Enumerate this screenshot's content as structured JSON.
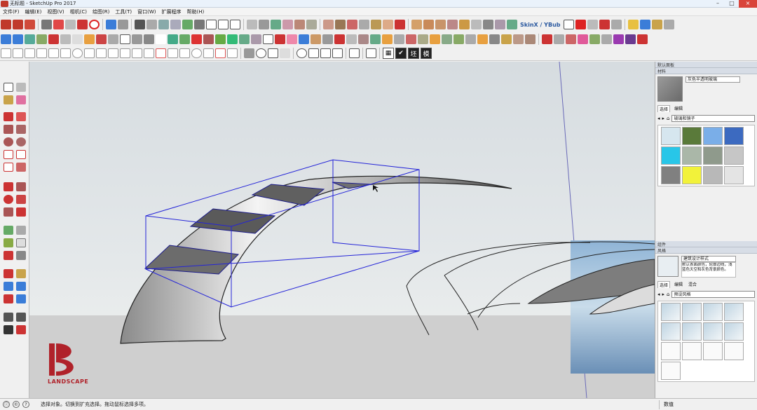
{
  "window": {
    "title": "无标题 - SketchUp Pro 2017"
  },
  "menu": [
    "文件(F)",
    "编辑(E)",
    "视图(V)",
    "相机(C)",
    "绘图(R)",
    "工具(T)",
    "窗口(W)",
    "扩展程序",
    "帮助(H)"
  ],
  "toolbar": {
    "plugin_label": "SkinX / YBub",
    "style_buttons": [
      "▦",
      "✔",
      "坯",
      "模"
    ]
  },
  "watermark": {
    "brand": "LANDSCAPE"
  },
  "tray": {
    "header": "默认面板",
    "materials": {
      "section": "材料",
      "name": "灰色半透明玻璃",
      "tabs": [
        "选择",
        "编辑"
      ],
      "collection": "玻璃和镜子",
      "swatches": [
        "#d6e6ef",
        "#5a7a3a",
        "#7aaee8",
        "#3c6ac0",
        "#28c6e8",
        "#aab7a8",
        "#8f9a8c",
        "#c6c6c6",
        "#808080",
        "#f2f23a",
        "#b8b8b8",
        "#e4e4e4"
      ]
    },
    "components": {
      "section": "组件"
    },
    "styles": {
      "section": "风格",
      "name": "建筑设计样式",
      "description": "默认表面颜色，轮廓边线，浅蓝色天空和灰色背景颜色。",
      "tabs": [
        "选择",
        "编辑",
        "混合"
      ],
      "collection": "预设风格"
    }
  },
  "status": {
    "message": "选择对象。切换到扩充选择。拖动鼠标选择多项。",
    "measurement_label": "数值"
  }
}
